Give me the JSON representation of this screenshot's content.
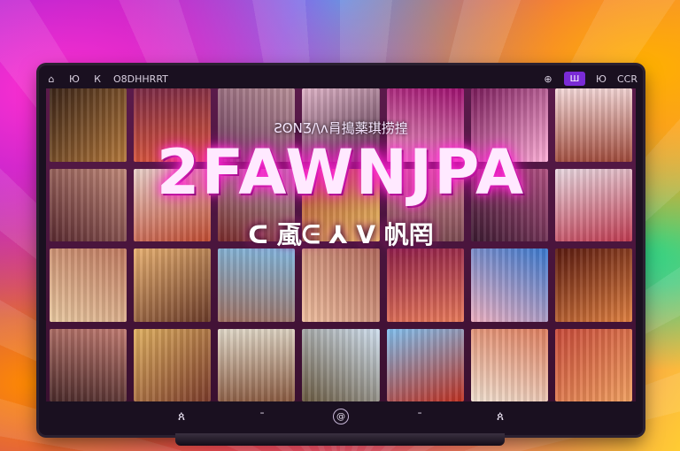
{
  "topbar": {
    "left_items": [
      "⌂",
      "Ю",
      "К",
      "O8DHHRRT"
    ],
    "right_items": [
      "⊕",
      "Ш",
      "Ю",
      "CCR"
    ],
    "badge_icon": "grid-icon"
  },
  "overlay": {
    "top_text": "ƧʘNƷ/\\ᴧ肙搗薬琪捞揘",
    "title": "2FAWNJPA",
    "subtitle": "ᑕ 颪ᕮ ⅄ ᐯ 帆罔"
  },
  "colors": {
    "screen_bg": "#5a1a4a",
    "glow": "#ff38d8",
    "monitor_frame": "#1a1020"
  },
  "tiles": [
    {
      "c1": "#3a2418",
      "c2": "#b4783a"
    },
    {
      "c1": "#7a2a46",
      "c2": "#e05a3a"
    },
    {
      "c1": "#b89098",
      "c2": "#6a3a5a"
    },
    {
      "c1": "#e0b4c8",
      "c2": "#4a2a40"
    },
    {
      "c1": "#a01070",
      "c2": "#e8a0c0"
    },
    {
      "c1": "#7a1a5a",
      "c2": "#ffb0d8"
    },
    {
      "c1": "#f4d8d8",
      "c2": "#a04a3a"
    },
    {
      "c1": "#c08878",
      "c2": "#5a2a30"
    },
    {
      "c1": "#e8d0c8",
      "c2": "#c04a30"
    },
    {
      "c1": "#b0a0a8",
      "c2": "#7a2a2a"
    },
    {
      "c1": "#b04a30",
      "c2": "#e8c060"
    },
    {
      "c1": "#d08090",
      "c2": "#7a4a50"
    },
    {
      "c1": "#b05080",
      "c2": "#3a1a30"
    },
    {
      "c1": "#e8d8e0",
      "c2": "#c03a50"
    },
    {
      "c1": "#c07a60",
      "c2": "#e8c8a0"
    },
    {
      "c1": "#e8b070",
      "c2": "#6a3a28"
    },
    {
      "c1": "#80b8e0",
      "c2": "#a07060"
    },
    {
      "c1": "#b0685a",
      "c2": "#f0c0a0"
    },
    {
      "c1": "#902048",
      "c2": "#e87a5a"
    },
    {
      "c1": "#3a7ad0",
      "c2": "#f0b0c0"
    },
    {
      "c1": "#5a1a10",
      "c2": "#e08040"
    },
    {
      "c1": "#c07a70",
      "c2": "#4a2a2a"
    },
    {
      "c1": "#e0b060",
      "c2": "#7a3a2a"
    },
    {
      "c1": "#e0d8c8",
      "c2": "#8a5a40"
    },
    {
      "c1": "#d0e0f0",
      "c2": "#6a5a40"
    },
    {
      "c1": "#80c0f0",
      "c2": "#c03020"
    },
    {
      "c1": "#e08060",
      "c2": "#f0e0d0"
    },
    {
      "c1": "#c84a3a",
      "c2": "#f0a060"
    }
  ],
  "bottombar": {
    "left_icon": "ጰ",
    "mid_left_icon": "ᐨ",
    "center_icon": "@",
    "mid_right_icon": "ᐨ",
    "right_icon": "ጰ"
  }
}
